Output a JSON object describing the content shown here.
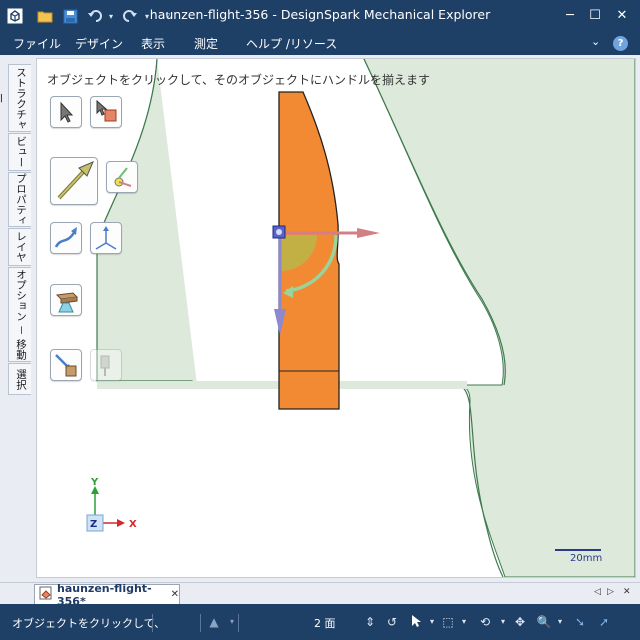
{
  "window": {
    "title": "haunzen-flight-356 - DesignSpark Mechanical Explorer",
    "minimize": "─",
    "maximize": "☐",
    "close": "✕"
  },
  "menu": {
    "items": [
      "ファイル",
      "デザイン",
      "表示",
      "測定",
      "ヘルプ /リソース"
    ],
    "collapse": "⌄",
    "help": "?"
  },
  "left_tabs": [
    "ストラクチャー",
    "ビュー",
    "プロパティ",
    "レイヤ",
    "オプション － 移動",
    "選択"
  ],
  "viewport": {
    "hint": "オブジェクトをクリックして、そのオブジェクトにハンドルを揃えます",
    "scale_label": "20mm",
    "triad": {
      "y": "Y",
      "z": "Z",
      "x": "X"
    }
  },
  "colors": {
    "chrome": "#1e3f66",
    "sketch_fill": "#dde9da",
    "sketch_stroke": "#3f7a4f",
    "part_fill": "#f18a33",
    "axis_x": "#d27f86",
    "axis_y": "#8e88d0"
  },
  "doc_tab": {
    "label": "haunzen-flight-356*",
    "close": "✕",
    "nav_prev": "◁",
    "nav_next": "▷",
    "nav_menu": "✕"
  },
  "status": {
    "message": "オブジェクトをクリックして、",
    "face_count": "2 面"
  }
}
